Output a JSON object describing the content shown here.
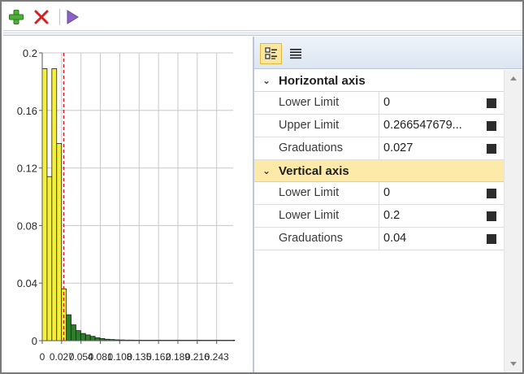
{
  "toolbar": {
    "icons": [
      "add-icon",
      "delete-icon",
      "run-icon"
    ]
  },
  "property_toolbar": {
    "icons": [
      "categorized-view-icon",
      "list-view-icon"
    ]
  },
  "properties": {
    "horizontal": {
      "title": "Horizontal axis",
      "rows": [
        {
          "name": "Lower Limit",
          "value": "0"
        },
        {
          "name": "Upper Limit",
          "value": "0.266547679..."
        },
        {
          "name": "Graduations",
          "value": "0.027"
        }
      ]
    },
    "vertical": {
      "title": "Vertical axis",
      "rows": [
        {
          "name": "Lower Limit",
          "value": "0"
        },
        {
          "name": "Lower Limit",
          "value": "0.2"
        },
        {
          "name": "Graduations",
          "value": "0.04"
        }
      ]
    }
  },
  "colors": {
    "bar_yellow": "#f5f03c",
    "bar_green": "#2f7d2f",
    "threshold_line": "#dd1f1f",
    "selected_category": "#fde9a8"
  },
  "chart_data": {
    "type": "bar",
    "ylim": [
      0,
      0.2
    ],
    "xlim": [
      0,
      0.266
    ],
    "y_ticks": [
      "0",
      "0.04",
      "0.08",
      "0.12",
      "0.16",
      "0.2"
    ],
    "x_ticks": [
      "0",
      "0.027",
      "0.054",
      "0.081",
      "0.108",
      "0.135",
      "0.162",
      "0.189",
      "0.216",
      "0.243"
    ],
    "threshold_x": 0.03,
    "bin_width": 0.0067,
    "bars": [
      {
        "x": 0.0,
        "y": 0.189,
        "color": "yellow"
      },
      {
        "x": 0.0067,
        "y": 0.114,
        "color": "yellow"
      },
      {
        "x": 0.0134,
        "y": 0.189,
        "color": "yellow"
      },
      {
        "x": 0.0201,
        "y": 0.137,
        "color": "yellow"
      },
      {
        "x": 0.0268,
        "y": 0.036,
        "color": "yellow"
      },
      {
        "x": 0.0335,
        "y": 0.018,
        "color": "green"
      },
      {
        "x": 0.0402,
        "y": 0.011,
        "color": "green"
      },
      {
        "x": 0.0469,
        "y": 0.007,
        "color": "green"
      },
      {
        "x": 0.0536,
        "y": 0.005,
        "color": "green"
      },
      {
        "x": 0.0603,
        "y": 0.004,
        "color": "green"
      },
      {
        "x": 0.067,
        "y": 0.003,
        "color": "green"
      },
      {
        "x": 0.0737,
        "y": 0.002,
        "color": "green"
      },
      {
        "x": 0.0804,
        "y": 0.0015,
        "color": "green"
      },
      {
        "x": 0.0871,
        "y": 0.001,
        "color": "green"
      },
      {
        "x": 0.0938,
        "y": 0.0008,
        "color": "green"
      },
      {
        "x": 0.1005,
        "y": 0.0006,
        "color": "green"
      },
      {
        "x": 0.1072,
        "y": 0.0005,
        "color": "green"
      },
      {
        "x": 0.1139,
        "y": 0.0004,
        "color": "green"
      },
      {
        "x": 0.1206,
        "y": 0.0004,
        "color": "green"
      },
      {
        "x": 0.1273,
        "y": 0.0003,
        "color": "green"
      },
      {
        "x": 0.134,
        "y": 0.0003,
        "color": "green"
      },
      {
        "x": 0.1407,
        "y": 0.0002,
        "color": "green"
      },
      {
        "x": 0.1474,
        "y": 0.0002,
        "color": "green"
      },
      {
        "x": 0.1541,
        "y": 0.0002,
        "color": "green"
      },
      {
        "x": 0.1608,
        "y": 0.0002,
        "color": "green"
      },
      {
        "x": 0.1675,
        "y": 0.0002,
        "color": "green"
      },
      {
        "x": 0.1742,
        "y": 0.0002,
        "color": "green"
      },
      {
        "x": 0.1809,
        "y": 0.0002,
        "color": "green"
      },
      {
        "x": 0.1876,
        "y": 0.0002,
        "color": "green"
      },
      {
        "x": 0.1943,
        "y": 0.0002,
        "color": "green"
      },
      {
        "x": 0.201,
        "y": 0.0002,
        "color": "green"
      },
      {
        "x": 0.2077,
        "y": 0.0002,
        "color": "green"
      },
      {
        "x": 0.2144,
        "y": 0.0002,
        "color": "green"
      },
      {
        "x": 0.2211,
        "y": 0.0002,
        "color": "green"
      },
      {
        "x": 0.2278,
        "y": 0.0002,
        "color": "green"
      },
      {
        "x": 0.2345,
        "y": 0.0002,
        "color": "green"
      },
      {
        "x": 0.2412,
        "y": 0.0002,
        "color": "green"
      },
      {
        "x": 0.2479,
        "y": 0.0002,
        "color": "green"
      },
      {
        "x": 0.2546,
        "y": 0.0002,
        "color": "green"
      },
      {
        "x": 0.2613,
        "y": 0.0002,
        "color": "green"
      }
    ]
  }
}
